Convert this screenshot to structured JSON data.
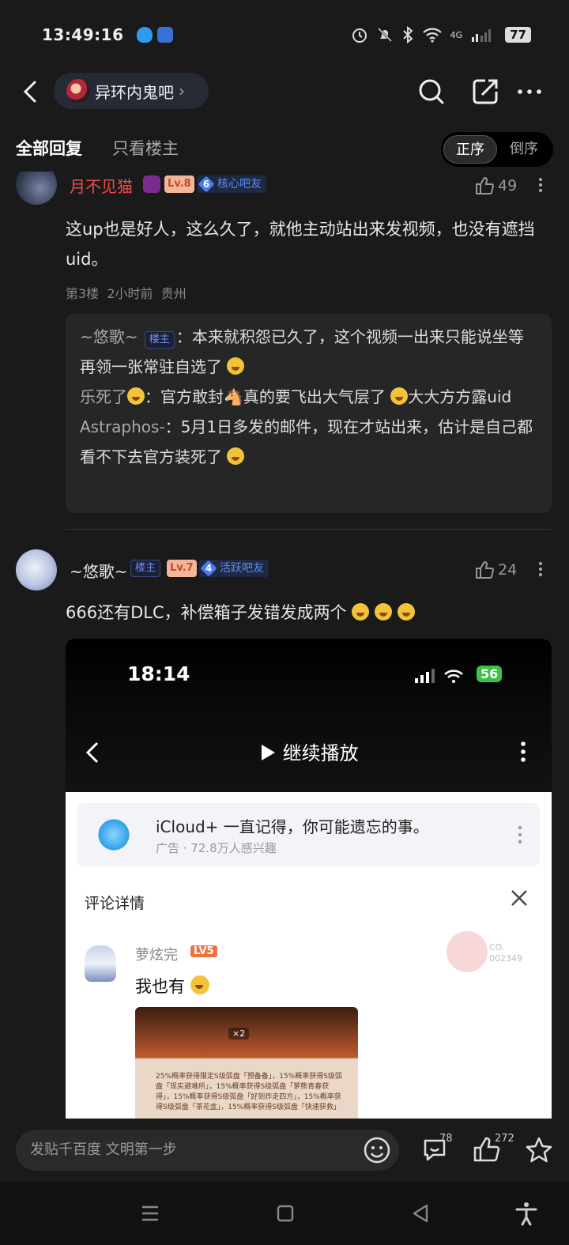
{
  "status_bar": {
    "time": "13:49:16",
    "network_4g": "4G",
    "battery": "77"
  },
  "header": {
    "forum_name": "异环内鬼吧",
    "chevron": "›"
  },
  "tabs": {
    "all_replies": "全部回复",
    "op_only": "只看楼主",
    "sort_asc": "正序",
    "sort_desc": "倒序"
  },
  "posts": [
    {
      "username": "月不见猫",
      "level": "Lv.8",
      "badge_num": "6",
      "badge_label": "核心吧友",
      "likes": "49",
      "content": "这up也是好人，这么久了，就他主动站出来发视频，也没有遮挡uid。",
      "floor": "第3楼",
      "time": "2小时前",
      "location": "贵州",
      "replies": [
        {
          "name": "~悠歌~",
          "tag": "楼主",
          "sep": "：",
          "text": "本来就积怨已久了，这个视频一出来只能说坐等再领一张常驻自选了"
        },
        {
          "name": "乐死了",
          "sep": "：",
          "text": "官方敢封🐴真的要飞出大气层了",
          "text2": "大大方方露uid"
        },
        {
          "name": "Astraphos-",
          "sep": "：",
          "text": "5月1日多发的邮件，现在才站出来，估计是自己都看不下去官方装死了"
        }
      ]
    },
    {
      "username": "~悠歌~",
      "tag": "楼主",
      "level": "Lv.7",
      "badge_num": "4",
      "badge_label": "活跃吧友",
      "likes": "24",
      "content": "666还有DLC，补偿箱子发错发成两个",
      "screenshot": {
        "time": "18:14",
        "battery": "56",
        "play_label": "继续播放",
        "ad_title": "iCloud+ 一直记得，你可能遗忘的事。",
        "ad_sub": "广告 · 72.8万人感兴趣",
        "detail_title": "评论详情",
        "commenter": "萝炫完",
        "commenter_lv": "LV5",
        "comment": "我也有",
        "code_line1": "CO.",
        "code_line2": "002349",
        "image_text": "25%概率获得限定S级弧盘「预备备」，15%概率获得S级弧盘「现实避难所」，15%概率获得S级弧盘「萝熊青春获得」，15%概率获得S级弧盘「好到炸走四方」，15%概率获得S级弧盘「茶花盒」，15%概率获得S级弧盘「快速获救」",
        "image_badge": "×2"
      }
    }
  ],
  "bottom_bar": {
    "placeholder": "发贴千百度 文明第一步",
    "comment_count": "78",
    "like_count": "272"
  }
}
